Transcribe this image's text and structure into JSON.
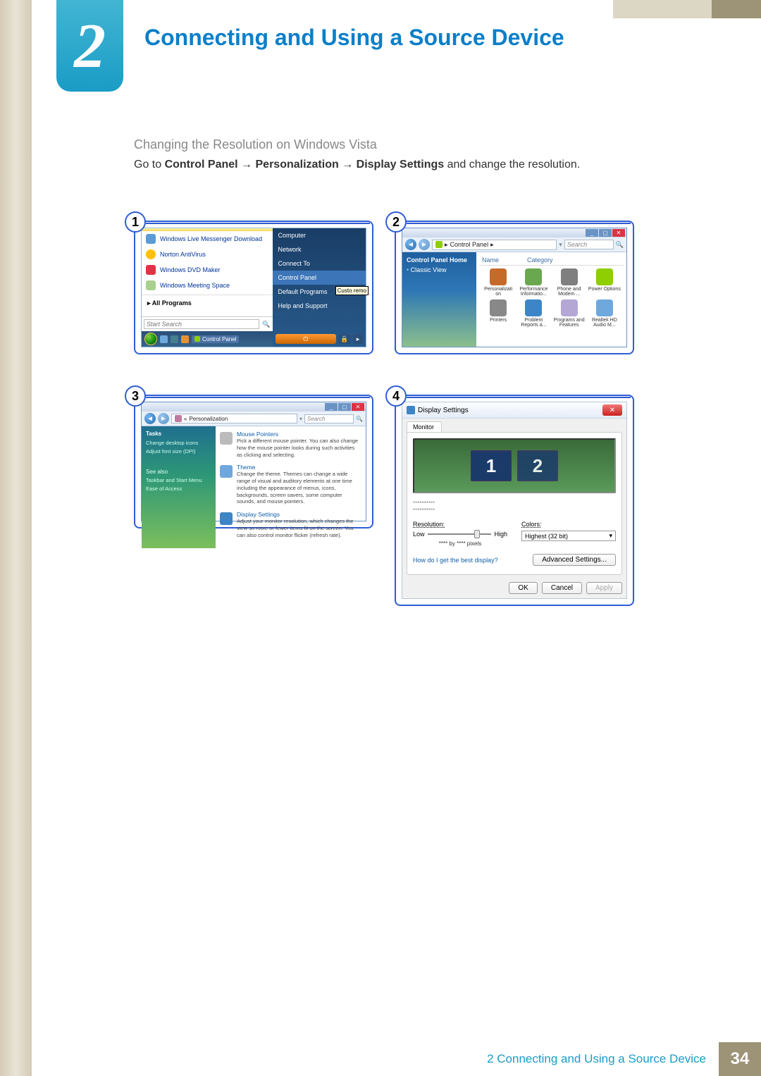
{
  "chapter": {
    "number": "2",
    "title": "Connecting and Using a Source Device"
  },
  "section": {
    "subheading": "Changing the Resolution on Windows Vista",
    "instruction_prefix": "Go to ",
    "instruction_bold1": "Control Panel",
    "instruction_arrow": " → ",
    "instruction_bold2": "Personalization",
    "instruction_bold3": "Display Settings",
    "instruction_suffix": " and change the resolution."
  },
  "steps": {
    "n1": "1",
    "n2": "2",
    "n3": "3",
    "n4": "4"
  },
  "step1": {
    "left_items": [
      "Windows Live Messenger Download",
      "Norton AntiVirus",
      "Windows DVD Maker",
      "Windows Meeting Space"
    ],
    "all_programs": "All Programs",
    "search_placeholder": "Start Search",
    "right_items": [
      "Computer",
      "Network",
      "Connect To",
      "Control Panel",
      "Default Programs",
      "Help and Support"
    ],
    "tooltip": "Custo remo",
    "taskbar_task": "Control Panel"
  },
  "step2": {
    "breadcrumb": "Control Panel",
    "search_placeholder": "Search",
    "side": {
      "home": "Control Panel Home",
      "classic": "Classic View"
    },
    "headers": {
      "name": "Name",
      "category": "Category"
    },
    "icons": [
      "Personalizati on",
      "Performance Informatio...",
      "Phone and Modem ...",
      "Power Options",
      "Printers",
      "Problem Reports a...",
      "Programs and Features",
      "Realtek HD Audio M..."
    ],
    "icon_colors": [
      "#c66a2b",
      "#6aa84f",
      "#7f7f7f",
      "#8fce00",
      "#888",
      "#3d85c6",
      "#b4a7d6",
      "#6fa8dc"
    ]
  },
  "step3": {
    "breadcrumb": "Personalization",
    "search_placeholder": "Search",
    "side": {
      "tasks": "Tasks",
      "links": [
        "Change desktop icons",
        "Adjust font size (DPI)"
      ],
      "seealso": "See also",
      "see_links": [
        "Taskbar and Start Menu",
        "Ease of Access"
      ]
    },
    "items": [
      {
        "title": "Mouse Pointers",
        "desc": "Pick a different mouse pointer. You can also change how the mouse pointer looks during such activities as clicking and selecting."
      },
      {
        "title": "Theme",
        "desc": "Change the theme. Themes can change a wide range of visual and auditory elements at one time including the appearance of menus, icons, backgrounds, screen savers, some computer sounds, and mouse pointers."
      },
      {
        "title": "Display Settings",
        "desc": "Adjust your monitor resolution, which changes the view so more or fewer items fit on the screen. You can also control monitor flicker (refresh rate)."
      }
    ]
  },
  "step4": {
    "title": "Display Settings",
    "tab": "Monitor",
    "monitors": [
      "1",
      "2"
    ],
    "mon_desc1": "**********",
    "mon_desc2": "**********",
    "resolution_label": "Resolution:",
    "low": "Low",
    "high": "High",
    "res_text": "**** by **** pixels",
    "colors_label": "Colors:",
    "colors_value": "Highest (32 bit)",
    "help_link": "How do I get the best display?",
    "adv_btn": "Advanced Settings...",
    "ok": "OK",
    "cancel": "Cancel",
    "apply": "Apply"
  },
  "footer": {
    "text": "2 Connecting and Using a Source Device",
    "page": "34"
  }
}
